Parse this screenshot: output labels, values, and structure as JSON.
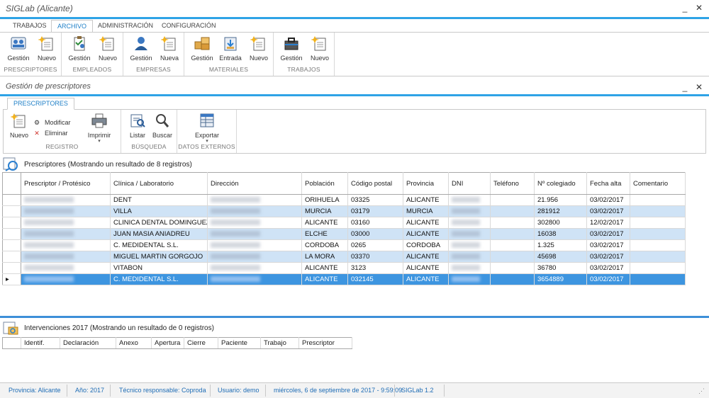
{
  "window": {
    "title": "SIGLab (Alicante)",
    "minimize": "_",
    "close": "✕"
  },
  "ribbon_tabs": [
    "TRABAJOS",
    "ARCHIVO",
    "ADMINISTRACIÓN",
    "CONFIGURACIÓN"
  ],
  "ribbon_groups": [
    {
      "label": "PRESCRIPTORES",
      "buttons": [
        "Gestión",
        "Nuevo"
      ]
    },
    {
      "label": "EMPLEADOS",
      "buttons": [
        "Gestión",
        "Nuevo"
      ]
    },
    {
      "label": "EMPRESAS",
      "buttons": [
        "Gestión",
        "Nueva"
      ]
    },
    {
      "label": "MATERIALES",
      "buttons": [
        "Gestión",
        "Entrada",
        "Nuevo"
      ]
    },
    {
      "label": "TRABAJOS",
      "buttons": [
        "Gestión",
        "Nuevo"
      ]
    }
  ],
  "child": {
    "title": "Gestión de prescriptores",
    "tab": "PRESCRIPTORES",
    "groups": {
      "registro": {
        "label": "REGISTRO",
        "nuevo": "Nuevo",
        "modificar": "Modificar",
        "eliminar": "Eliminar",
        "imprimir": "Imprimir"
      },
      "busqueda": {
        "label": "BÚSQUEDA",
        "listar": "Listar",
        "buscar": "Buscar"
      },
      "externos": {
        "label": "DATOS EXTERNOS",
        "exportar": "Exportar"
      }
    }
  },
  "grid": {
    "title": "Prescriptores (Mostrando un resultado de 8 registros)",
    "columns": [
      "Prescriptor / Protésico",
      "Clínica / Laboratorio",
      "Dirección",
      "Población",
      "Código postal",
      "Provincia",
      "DNI",
      "Teléfono",
      "Nº colegiado",
      "Fecha alta",
      "Comentario"
    ],
    "rows": [
      {
        "clinica": "DENT",
        "poblacion": "ORIHUELA",
        "cp": "03325",
        "provincia": "ALICANTE",
        "colegiado": "21.956",
        "fecha": "03/02/2017"
      },
      {
        "clinica": "VILLA",
        "poblacion": "MURCIA",
        "cp": "03179",
        "provincia": "MURCIA",
        "colegiado": "281912",
        "fecha": "03/02/2017"
      },
      {
        "clinica": "CLINICA DENTAL DOMINGUEZ",
        "poblacion": "ALICANTE",
        "cp": "03160",
        "provincia": "ALICANTE",
        "colegiado": "302800",
        "fecha": "12/02/2017"
      },
      {
        "clinica": "JUAN MASIA ANIADREU",
        "poblacion": "ELCHE",
        "cp": "03000",
        "provincia": "ALICANTE",
        "colegiado": "16038",
        "fecha": "03/02/2017"
      },
      {
        "clinica": "C. MEDIDENTAL S.L.",
        "poblacion": "CORDOBA",
        "cp": "0265",
        "provincia": "CORDOBA",
        "colegiado": "1.325",
        "fecha": "03/02/2017"
      },
      {
        "clinica": "MIGUEL MARTIN GORGOJO",
        "poblacion": "LA MORA",
        "cp": "03370",
        "provincia": "ALICANTE",
        "colegiado": "45698",
        "fecha": "03/02/2017"
      },
      {
        "clinica": "VITABON",
        "poblacion": "ALICANTE",
        "cp": "3123",
        "provincia": "ALICANTE",
        "colegiado": "36780",
        "fecha": "03/02/2017"
      },
      {
        "clinica": "C. MEDIDENTAL  S.L.",
        "poblacion": "ALICANTE",
        "cp": "032145",
        "provincia": "ALICANTE",
        "colegiado": "3654889",
        "fecha": "03/02/2017"
      }
    ],
    "current_row_marker": "▸"
  },
  "interventions": {
    "title": "Intervenciones 2017 (Mostrando un resultado de 0 registros)",
    "columns": [
      "Identif.",
      "Declaración",
      "Anexo",
      "Apertura",
      "Cierre",
      "Paciente",
      "Trabajo",
      "Prescriptor"
    ]
  },
  "status": {
    "provincia": "Provincia: Alicante",
    "anio": "Año: 2017",
    "tecnico": "Técnico responsable: Coproda",
    "usuario": "Usuario: demo",
    "fecha": "miércoles, 6 de septiembre de 2017 - 9:59:09",
    "version": "SIGLab 1.2"
  },
  "colors": {
    "accent": "#2ea3e6",
    "selected_row": "#3d95e0",
    "alt_row": "#cfe3f6",
    "status_text": "#1e6cb5"
  }
}
